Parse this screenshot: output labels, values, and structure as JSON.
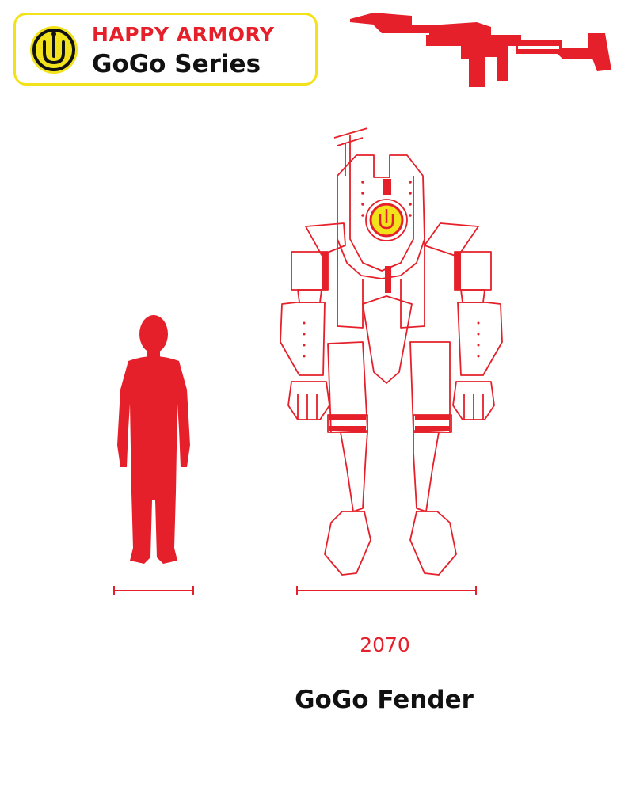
{
  "brand": {
    "title": "HAPPY ARMORY",
    "series": "GoGo Series",
    "logo_icon": "smiley-face-logo-icon"
  },
  "weapon": {
    "icon": "rifle-silhouette-icon"
  },
  "figures": {
    "human": {
      "icon": "human-silhouette-icon"
    },
    "robot": {
      "icon": "robot-mech-outline-icon"
    }
  },
  "caption": {
    "year": "2070",
    "name": "GoGo Fender"
  },
  "colors": {
    "accent_red": "#e5202a",
    "brand_yellow": "#f2e21b",
    "text_black": "#111111"
  }
}
